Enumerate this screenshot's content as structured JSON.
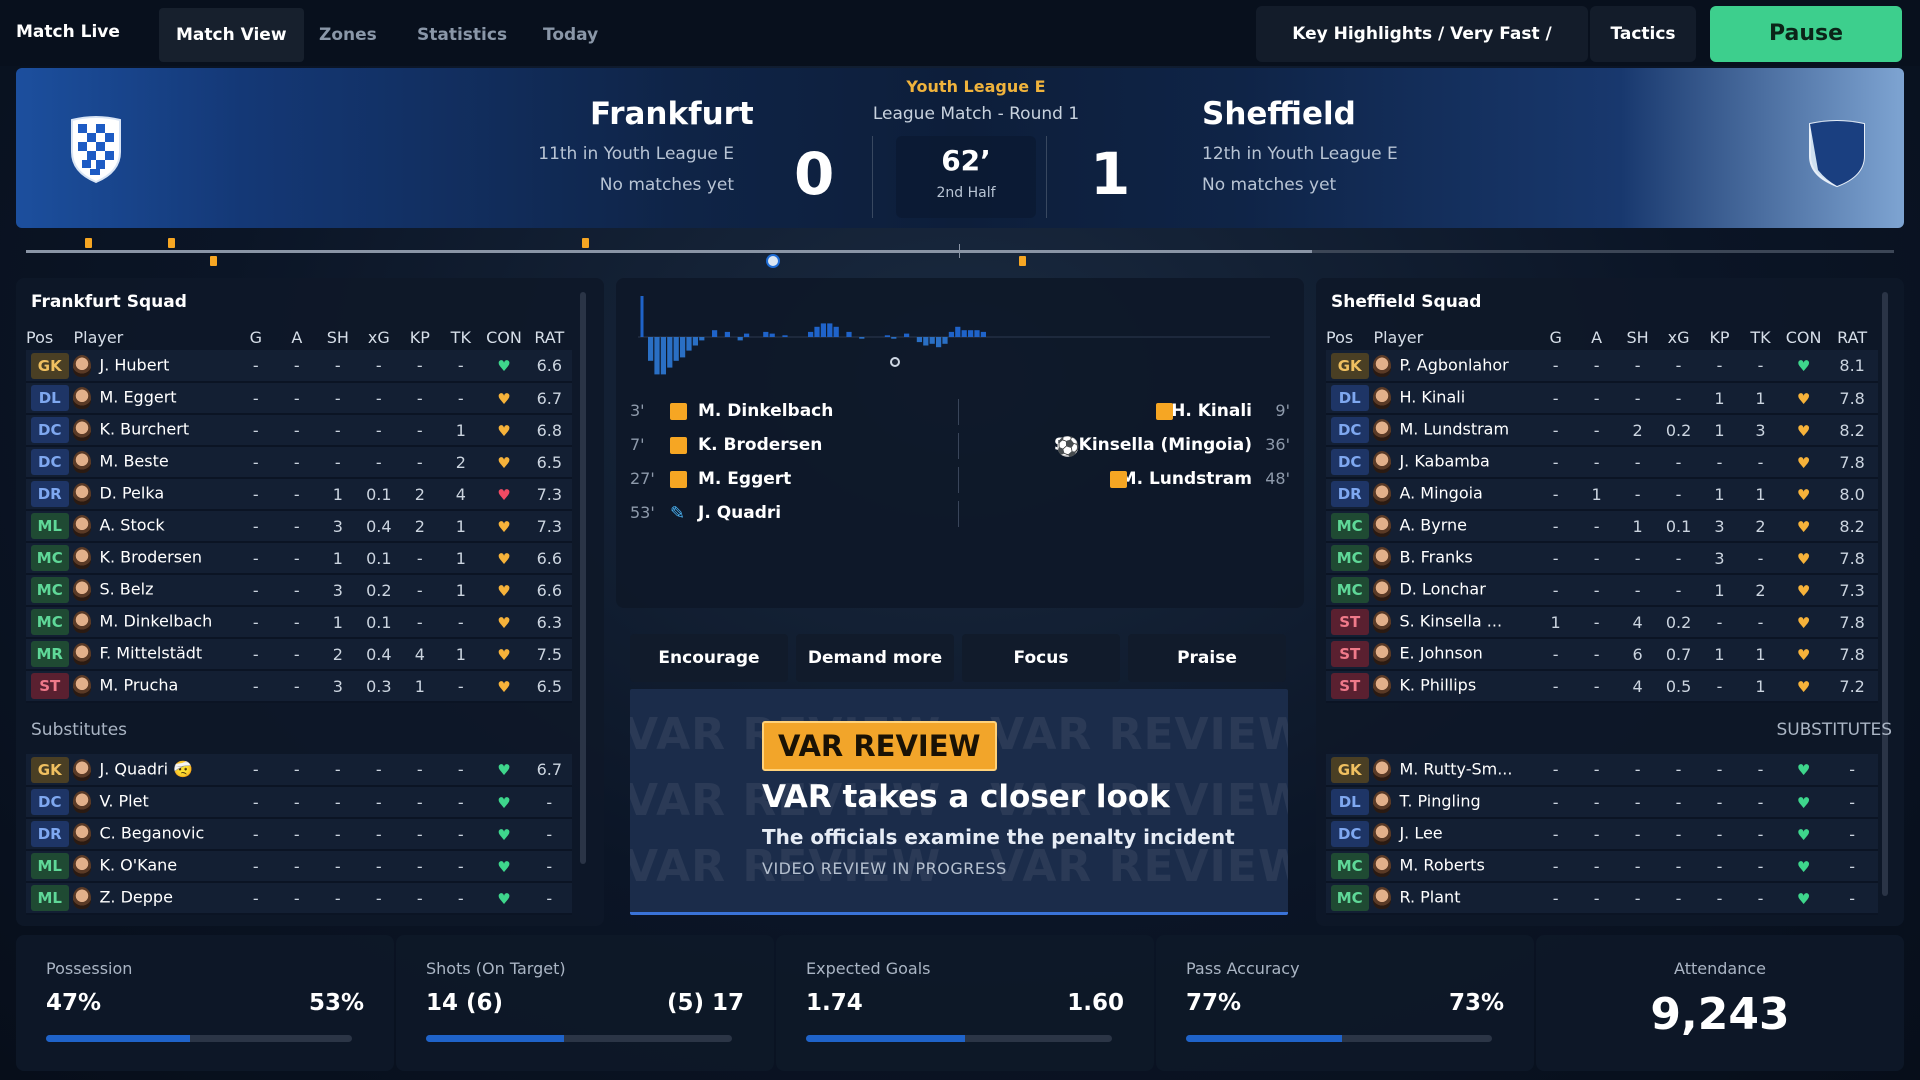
{
  "topbar": {
    "brand": "Match Live",
    "tabs": [
      "Match View",
      "Zones",
      "Statistics",
      "Today"
    ],
    "highlights": "Key Highlights / Very Fast / Normal",
    "tactics": "Tactics",
    "pause": "Pause"
  },
  "header": {
    "league": "Youth League E",
    "round": "League Match - Round 1",
    "home": {
      "name": "Frankfurt",
      "position": "11th in Youth League E",
      "form": "No matches yet",
      "score": "0"
    },
    "away": {
      "name": "Sheffield",
      "position": "12th in Youth League E",
      "form": "No matches yet",
      "score": "1"
    },
    "clock": "62’",
    "half": "2nd Half"
  },
  "home_squad": {
    "title": "Frankfurt Squad",
    "columns": [
      "Pos",
      "Player",
      "G",
      "A",
      "SH",
      "xG",
      "KP",
      "TK",
      "CON",
      "RAT"
    ],
    "players": [
      {
        "pos": "GK",
        "name": "J. Hubert",
        "g": "-",
        "a": "-",
        "sh": "-",
        "xg": "-",
        "kp": "-",
        "tk": "-",
        "con": "g",
        "rat": "6.6"
      },
      {
        "pos": "DL",
        "name": "M. Eggert",
        "g": "-",
        "a": "-",
        "sh": "-",
        "xg": "-",
        "kp": "-",
        "tk": "-",
        "con": "y",
        "rat": "6.7"
      },
      {
        "pos": "DC",
        "name": "K. Burchert",
        "g": "-",
        "a": "-",
        "sh": "-",
        "xg": "-",
        "kp": "-",
        "tk": "1",
        "con": "y",
        "rat": "6.8"
      },
      {
        "pos": "DC",
        "name": "M. Beste",
        "g": "-",
        "a": "-",
        "sh": "-",
        "xg": "-",
        "kp": "-",
        "tk": "2",
        "con": "y",
        "rat": "6.5"
      },
      {
        "pos": "DR",
        "name": "D. Pelka",
        "g": "-",
        "a": "-",
        "sh": "1",
        "xg": "0.1",
        "kp": "2",
        "tk": "4",
        "con": "r",
        "rat": "7.3"
      },
      {
        "pos": "ML",
        "name": "A. Stock",
        "g": "-",
        "a": "-",
        "sh": "3",
        "xg": "0.4",
        "kp": "2",
        "tk": "1",
        "con": "y",
        "rat": "7.3"
      },
      {
        "pos": "MC",
        "name": "K. Brodersen",
        "g": "-",
        "a": "-",
        "sh": "1",
        "xg": "0.1",
        "kp": "-",
        "tk": "1",
        "con": "y",
        "rat": "6.6"
      },
      {
        "pos": "MC",
        "name": "S. Belz",
        "g": "-",
        "a": "-",
        "sh": "3",
        "xg": "0.2",
        "kp": "-",
        "tk": "1",
        "con": "y",
        "rat": "6.6"
      },
      {
        "pos": "MC",
        "name": "M. Dinkelbach",
        "g": "-",
        "a": "-",
        "sh": "1",
        "xg": "0.1",
        "kp": "-",
        "tk": "-",
        "con": "y",
        "rat": "6.3"
      },
      {
        "pos": "MR",
        "name": "F. Mittelstädt",
        "g": "-",
        "a": "-",
        "sh": "2",
        "xg": "0.4",
        "kp": "4",
        "tk": "1",
        "con": "y",
        "rat": "7.5"
      },
      {
        "pos": "ST",
        "name": "M. Prucha",
        "g": "-",
        "a": "-",
        "sh": "3",
        "xg": "0.3",
        "kp": "1",
        "tk": "-",
        "con": "y",
        "rat": "6.5"
      }
    ],
    "subs_label": "Substitutes",
    "subs": [
      {
        "pos": "GK",
        "name": "J. Quadri",
        "emoji": "🤕",
        "g": "-",
        "a": "-",
        "sh": "-",
        "xg": "-",
        "kp": "-",
        "tk": "-",
        "con": "g",
        "rat": "6.7"
      },
      {
        "pos": "DC",
        "name": "V. Plet",
        "g": "-",
        "a": "-",
        "sh": "-",
        "xg": "-",
        "kp": "-",
        "tk": "-",
        "con": "g",
        "rat": "-"
      },
      {
        "pos": "DR",
        "name": "C. Beganovic",
        "g": "-",
        "a": "-",
        "sh": "-",
        "xg": "-",
        "kp": "-",
        "tk": "-",
        "con": "g",
        "rat": "-"
      },
      {
        "pos": "ML",
        "name": "K. O'Kane",
        "g": "-",
        "a": "-",
        "sh": "-",
        "xg": "-",
        "kp": "-",
        "tk": "-",
        "con": "g",
        "rat": "-"
      },
      {
        "pos": "ML",
        "name": "Z. Deppe",
        "g": "-",
        "a": "-",
        "sh": "-",
        "xg": "-",
        "kp": "-",
        "tk": "-",
        "con": "g",
        "rat": "-"
      }
    ]
  },
  "away_squad": {
    "title": "Sheffield Squad",
    "columns": [
      "Pos",
      "Player",
      "G",
      "A",
      "SH",
      "xG",
      "KP",
      "TK",
      "CON",
      "RAT"
    ],
    "players": [
      {
        "pos": "GK",
        "name": "P. Agbonlahor",
        "g": "-",
        "a": "-",
        "sh": "-",
        "xg": "-",
        "kp": "-",
        "tk": "-",
        "con": "g",
        "rat": "8.1"
      },
      {
        "pos": "DL",
        "name": "H. Kinali",
        "g": "-",
        "a": "-",
        "sh": "-",
        "xg": "-",
        "kp": "1",
        "tk": "1",
        "con": "y",
        "rat": "7.8"
      },
      {
        "pos": "DC",
        "name": "M. Lundstram",
        "g": "-",
        "a": "-",
        "sh": "2",
        "xg": "0.2",
        "kp": "1",
        "tk": "3",
        "con": "y",
        "rat": "8.2"
      },
      {
        "pos": "DC",
        "name": "J. Kabamba",
        "g": "-",
        "a": "-",
        "sh": "-",
        "xg": "-",
        "kp": "-",
        "tk": "-",
        "con": "y",
        "rat": "7.8"
      },
      {
        "pos": "DR",
        "name": "A. Mingoia",
        "g": "-",
        "a": "1",
        "sh": "-",
        "xg": "-",
        "kp": "1",
        "tk": "1",
        "con": "y",
        "rat": "8.0"
      },
      {
        "pos": "MC",
        "name": "A. Byrne",
        "g": "-",
        "a": "-",
        "sh": "1",
        "xg": "0.1",
        "kp": "3",
        "tk": "2",
        "con": "y",
        "rat": "8.2"
      },
      {
        "pos": "MC",
        "name": "B. Franks",
        "g": "-",
        "a": "-",
        "sh": "-",
        "xg": "-",
        "kp": "3",
        "tk": "-",
        "con": "y",
        "rat": "7.8"
      },
      {
        "pos": "MC",
        "name": "D. Lonchar",
        "g": "-",
        "a": "-",
        "sh": "-",
        "xg": "-",
        "kp": "1",
        "tk": "2",
        "con": "y",
        "rat": "7.3"
      },
      {
        "pos": "ST",
        "name": "S. Kinsella ...",
        "g": "1",
        "a": "-",
        "sh": "4",
        "xg": "0.2",
        "kp": "-",
        "tk": "-",
        "con": "y",
        "rat": "7.8"
      },
      {
        "pos": "ST",
        "name": "E. Johnson",
        "g": "-",
        "a": "-",
        "sh": "6",
        "xg": "0.7",
        "kp": "1",
        "tk": "1",
        "con": "y",
        "rat": "7.8"
      },
      {
        "pos": "ST",
        "name": "K. Phillips",
        "g": "-",
        "a": "-",
        "sh": "4",
        "xg": "0.5",
        "kp": "-",
        "tk": "1",
        "con": "y",
        "rat": "7.2"
      }
    ],
    "subs_label": "SUBSTITUTES",
    "subs": [
      {
        "pos": "GK",
        "name": "M. Rutty-Sm...",
        "g": "-",
        "a": "-",
        "sh": "-",
        "xg": "-",
        "kp": "-",
        "tk": "-",
        "con": "g",
        "rat": "-"
      },
      {
        "pos": "DL",
        "name": "T. Pingling",
        "g": "-",
        "a": "-",
        "sh": "-",
        "xg": "-",
        "kp": "-",
        "tk": "-",
        "con": "g",
        "rat": "-"
      },
      {
        "pos": "DC",
        "name": "J. Lee",
        "g": "-",
        "a": "-",
        "sh": "-",
        "xg": "-",
        "kp": "-",
        "tk": "-",
        "con": "g",
        "rat": "-"
      },
      {
        "pos": "MC",
        "name": "M. Roberts",
        "g": "-",
        "a": "-",
        "sh": "-",
        "xg": "-",
        "kp": "-",
        "tk": "-",
        "con": "g",
        "rat": "-"
      },
      {
        "pos": "MC",
        "name": "R. Plant",
        "g": "-",
        "a": "-",
        "sh": "-",
        "xg": "-",
        "kp": "-",
        "tk": "-",
        "con": "g",
        "rat": "-"
      }
    ]
  },
  "events": {
    "home": [
      {
        "time": "3'",
        "type": "yellow",
        "player": "M. Dinkelbach"
      },
      {
        "time": "7'",
        "type": "yellow",
        "player": "K. Brodersen"
      },
      {
        "time": "27'",
        "type": "yellow",
        "player": "M. Eggert"
      },
      {
        "time": "53'",
        "type": "injury",
        "player": "J. Quadri"
      }
    ],
    "away": [
      {
        "time": "9'",
        "type": "yellow",
        "player": "H. Kinali"
      },
      {
        "time": "36'",
        "type": "goal",
        "player": "S. Kinsella (Mingoia)"
      },
      {
        "time": "48'",
        "type": "yellow",
        "player": "M. Lundstram"
      }
    ]
  },
  "momentum": [
    -14,
    -22,
    -22,
    -18,
    -14,
    -12,
    -8,
    -5,
    -2,
    0,
    4,
    0,
    3,
    0,
    -2,
    2,
    0,
    0,
    3,
    2,
    0,
    1,
    0,
    0,
    0,
    3,
    6,
    8,
    8,
    6,
    0,
    3,
    0,
    -1,
    0,
    0,
    0,
    1,
    -1,
    0,
    2,
    0,
    -3,
    -5,
    -4,
    -6,
    -4,
    3,
    6,
    4,
    4,
    4,
    3
  ],
  "shouts": [
    "Encourage",
    "Demand more",
    "Focus",
    "Praise"
  ],
  "var": {
    "badge": "VAR REVIEW",
    "title": "VAR takes a closer look",
    "desc": "The officials examine the penalty incident",
    "status": "VIDEO REVIEW IN PROGRESS",
    "watermark": "VAR REVIEW"
  },
  "stats": [
    {
      "label": "Possession",
      "home": "47%",
      "away": "53%",
      "home_share": 0.47
    },
    {
      "label": "Shots (On Target)",
      "home": "14 (6)",
      "away": "(5) 17",
      "home_share": 0.45
    },
    {
      "label": "Expected Goals",
      "home": "1.74",
      "away": "1.60",
      "home_share": 0.52
    },
    {
      "label": "Pass Accuracy",
      "home": "77%",
      "away": "73%",
      "home_share": 0.51
    }
  ],
  "attendance": {
    "label": "Attendance",
    "value": "9,243"
  },
  "colors": {
    "accent": "#3dcf8d",
    "yellow_card": "#f6a623",
    "home_bar": "#1f63c9"
  }
}
